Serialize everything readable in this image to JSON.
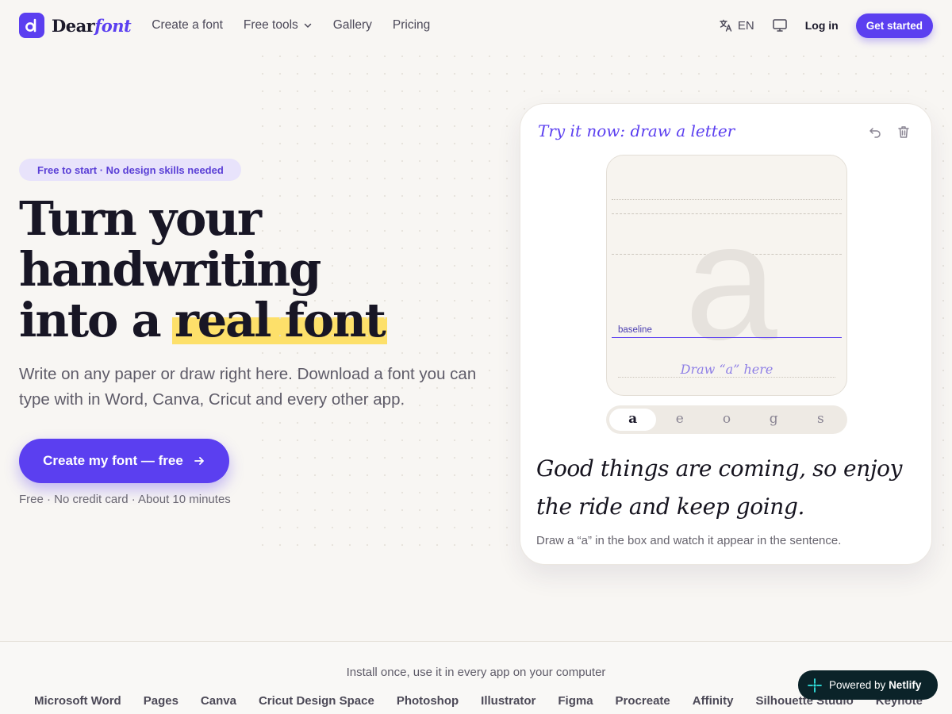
{
  "header": {
    "logo_word": "Dear",
    "logo_italic": "font",
    "nav": [
      "Create a font",
      "Free tools",
      "Gallery",
      "Pricing"
    ],
    "lang": "EN",
    "login": "Log in",
    "get_started": "Get started"
  },
  "hero": {
    "pill": "Free to start · No design skills needed",
    "title_line1": "Turn your",
    "title_line2": "handwriting",
    "title_line3_a": "into a ",
    "title_line3_b": "real font",
    "subtitle": "Write on any paper or draw right here. Download a font you can type with in Word, Canva, Cricut and every other app.",
    "cta": "Create my font — free",
    "note": "Free · No credit card · About 10 minutes"
  },
  "card": {
    "title": "Try it now: draw a letter",
    "ghost_letter": "a",
    "baseline_label": "baseline",
    "draw_hint": "Draw “a” here",
    "letters": [
      "a",
      "e",
      "o",
      "g",
      "s"
    ],
    "active_letter": "a",
    "sample_sentence": "Good things are coming, so enjoy the ride and keep going.",
    "note": "Draw a “a” in the box and watch it appear in the sentence."
  },
  "strip": {
    "title": "Install once, use it in every app on your computer",
    "apps": [
      "Microsoft Word",
      "Pages",
      "Canva",
      "Cricut Design Space",
      "Photoshop",
      "Illustrator",
      "Figma",
      "Procreate",
      "Affinity",
      "Silhouette Studio",
      "Keynote"
    ]
  },
  "badge": {
    "prefix": "Powered by",
    "brand": "Netlify"
  },
  "colors": {
    "accent": "#5b3ff0",
    "highlight": "#fde06a",
    "background": "#f8f6f3"
  }
}
